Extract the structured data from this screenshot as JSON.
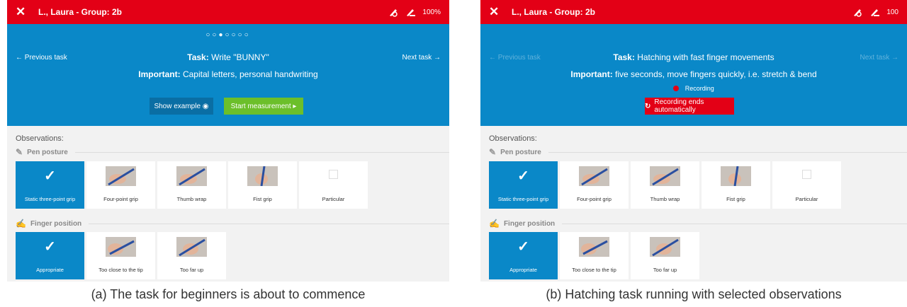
{
  "figures": [
    {
      "app_title": "L., Laura - Group: 2b",
      "battery": "100%",
      "page_dots": "○○●○○○○",
      "prev_task": "← Previous task",
      "next_task": "Next task →",
      "task_label": "Task:",
      "task_value": "Write \"BUNNY\"",
      "important_label": "Important:",
      "important_value": "Capital letters, personal handwriting",
      "show_example": "Show example ◉",
      "start_measurement": "Start measurement ▸",
      "observations": "Observations:",
      "pen_posture": "Pen posture",
      "pen_cards": [
        "Static three-point grip",
        "Four-point grip",
        "Thumb wrap",
        "Fist grip",
        "Particular"
      ],
      "finger_position": "Finger position",
      "finger_cards": [
        "Appropriate",
        "Too close to the tip",
        "Too far up"
      ],
      "caption": "(a) The task for beginners is about to commence"
    },
    {
      "app_title": "L., Laura - Group: 2b",
      "battery": "100",
      "prev_task": "← Previous task",
      "next_task": "Next task →",
      "task_label": "Task:",
      "task_value": "Hatching with fast finger movements",
      "important_label": "Important:",
      "important_value": "five seconds, move fingers quickly, i.e. stretch & bend",
      "recording": "Recording",
      "recording_ends": "Recording ends automatically",
      "observations": "Observations:",
      "pen_posture": "Pen posture",
      "pen_cards": [
        "Static three-point grip",
        "Four-point grip",
        "Thumb wrap",
        "Fist grip",
        "Particular"
      ],
      "finger_position": "Finger position",
      "finger_cards": [
        "Appropriate",
        "Too close to the tip",
        "Too far up"
      ],
      "caption": "(b) Hatching task running with selected observations"
    }
  ],
  "colors": {
    "red": "#e30016",
    "blue": "#0a88c8",
    "green": "#6cbf2a"
  },
  "icons": [
    "close-icon",
    "pen-off-icon",
    "pen-battery-icon",
    "eye-icon",
    "play-icon",
    "pen-posture-icon",
    "finger-position-icon",
    "checkmark-icon",
    "recording-dot-icon",
    "restart-icon"
  ]
}
